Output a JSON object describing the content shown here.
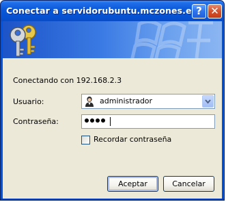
{
  "window": {
    "title": "Conectar a servidorubuntu.mczones.es",
    "help_glyph": "?",
    "close_glyph": "✕"
  },
  "banner": {
    "icon": "keys-icon",
    "deco": "xp-logo-watermark"
  },
  "dialog": {
    "connecting_text": "Conectando con 192.168.2.3",
    "user_label": "Usuario:",
    "user_value": "administrador",
    "user_icon": "user-account-icon",
    "password_label": "Contraseña:",
    "password_length": 4,
    "remember_label": "Recordar contraseña",
    "remember_checked": false
  },
  "buttons": {
    "ok_label": "Aceptar",
    "cancel_label": "Cancelar"
  },
  "colors": {
    "title_bar": "#0551d2",
    "dialog_face": "#ece9d8",
    "input_border": "#7f9db9",
    "close_button": "#d4512c"
  }
}
